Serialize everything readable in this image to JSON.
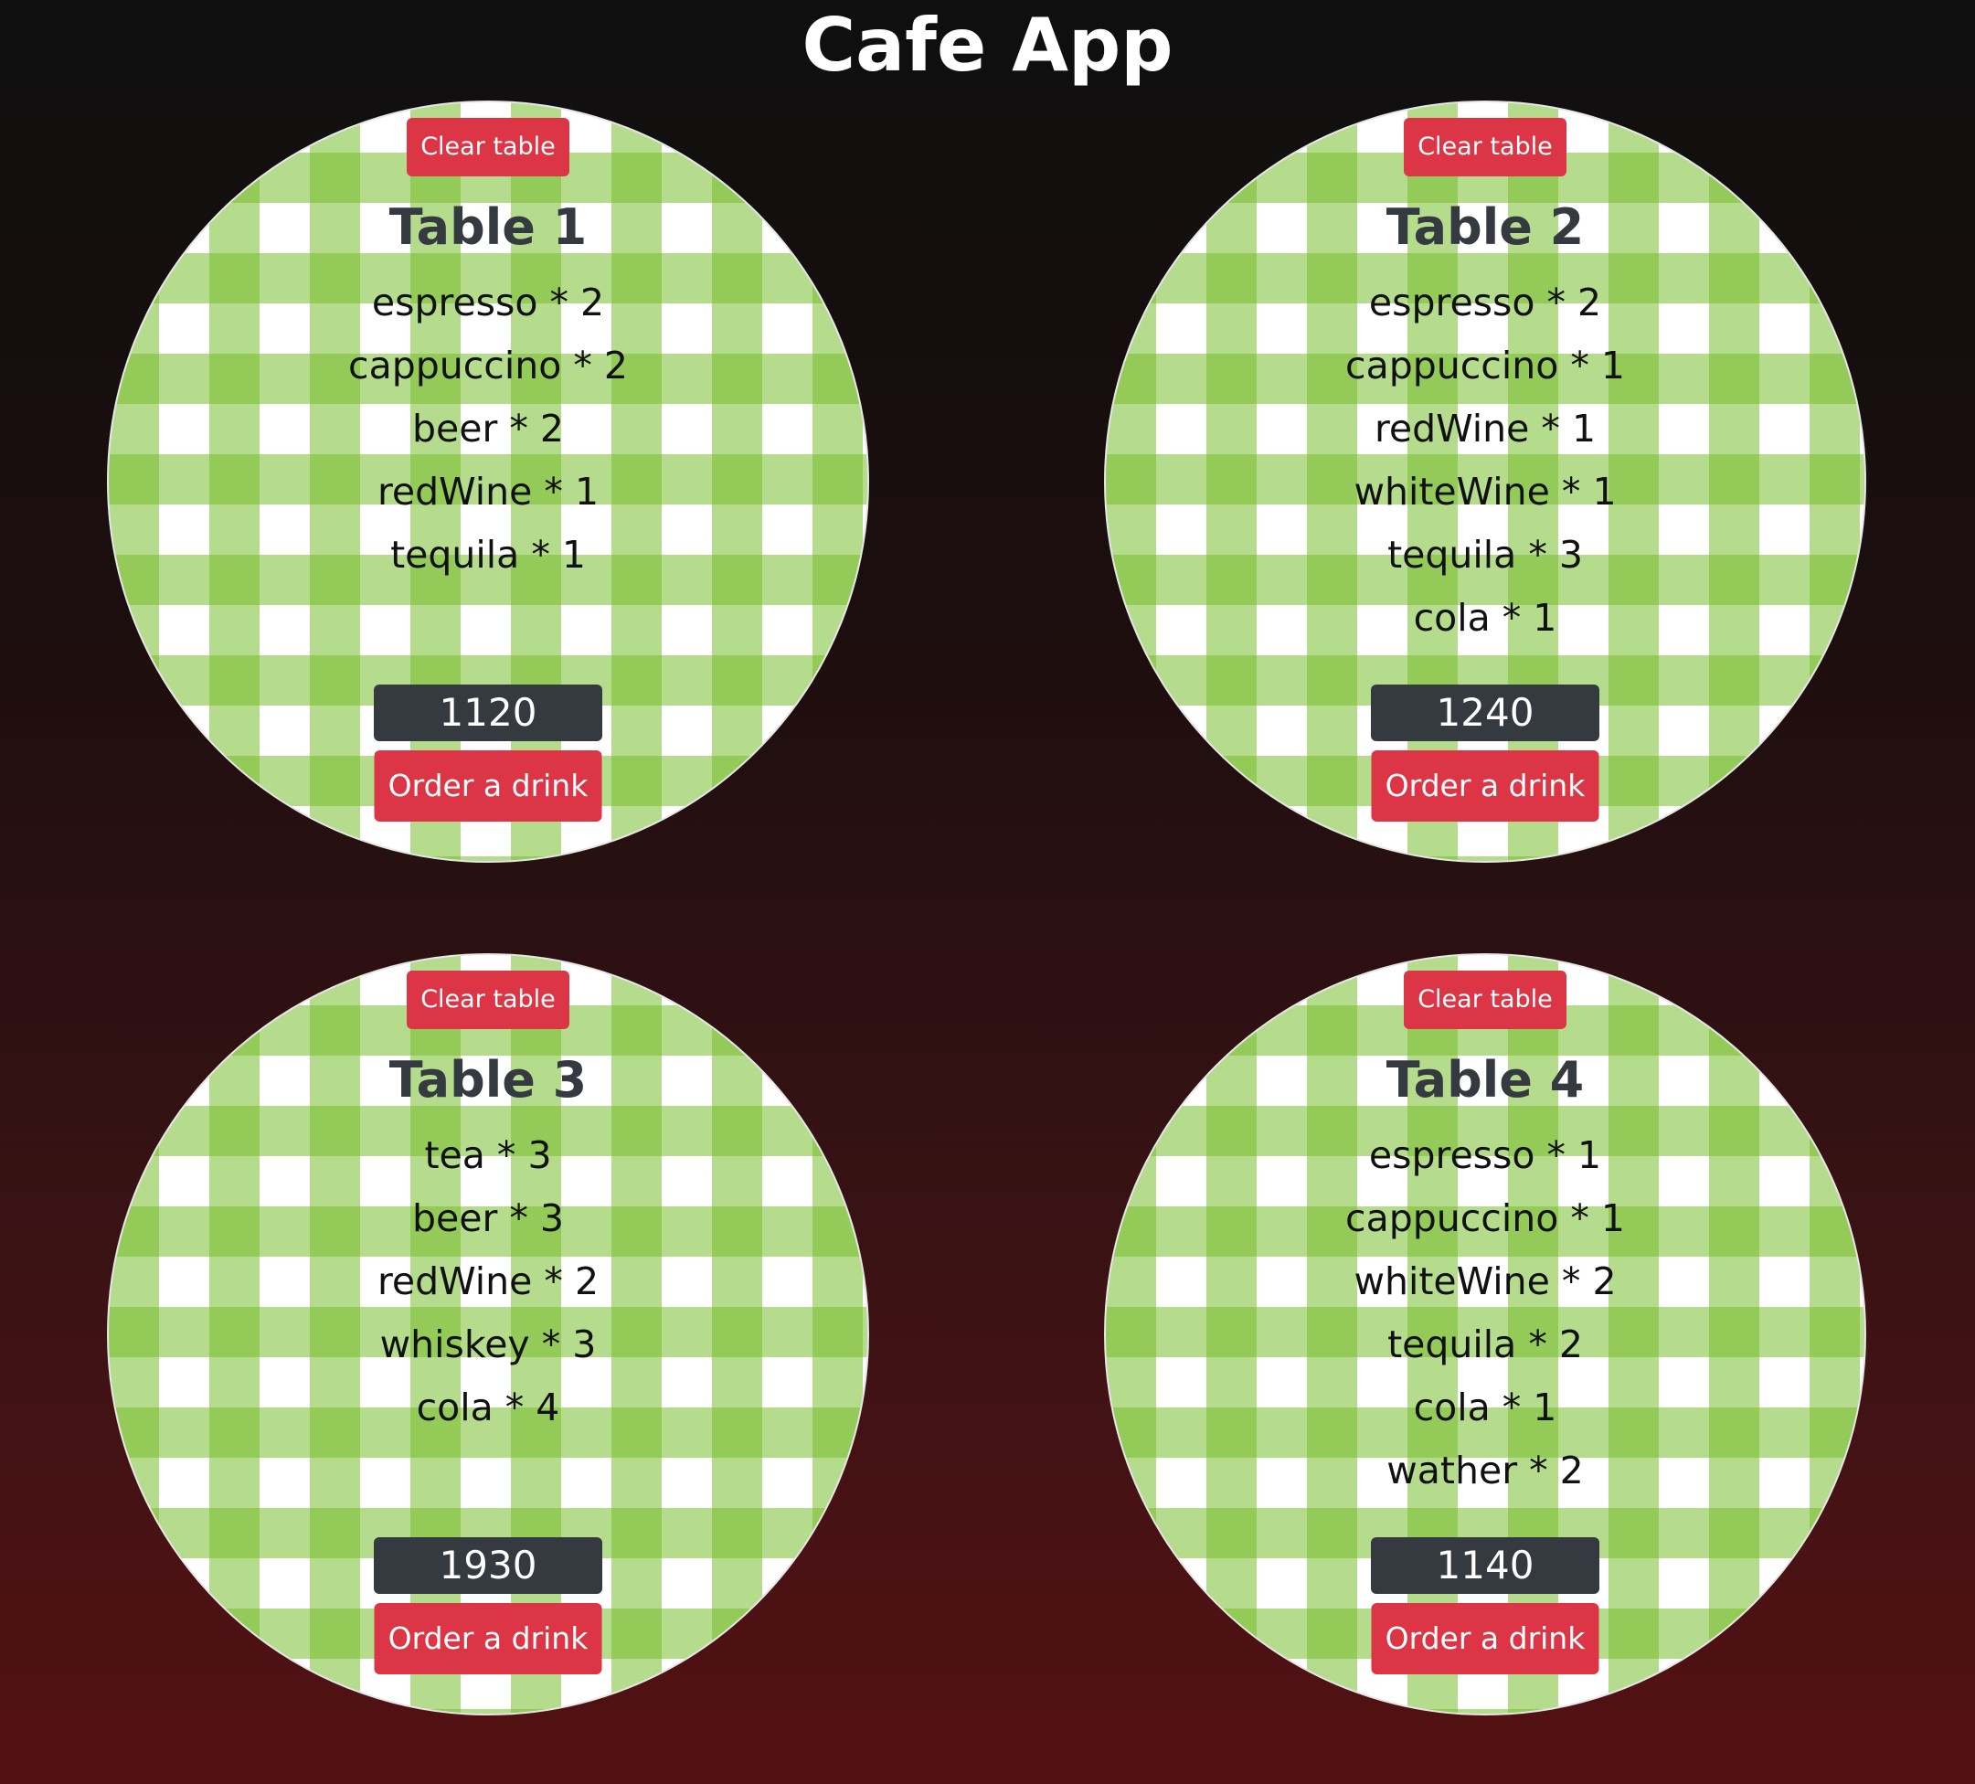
{
  "app": {
    "title": "Cafe App"
  },
  "colors": {
    "danger": "#dc3545",
    "dark": "#343a40",
    "gingham_green": "#78be2d"
  },
  "tables": [
    {
      "clear_label": "Clear table",
      "title": "Table 1",
      "orders": [
        "espresso * 2",
        "cappuccino * 2",
        "beer * 2",
        "redWine * 1",
        "tequila * 1"
      ],
      "total": "1120",
      "order_label": "Order a drink"
    },
    {
      "clear_label": "Clear table",
      "title": "Table 2",
      "orders": [
        "espresso * 2",
        "cappuccino * 1",
        "redWine * 1",
        "whiteWine * 1",
        "tequila * 3",
        "cola * 1"
      ],
      "total": "1240",
      "order_label": "Order a drink"
    },
    {
      "clear_label": "Clear table",
      "title": "Table 3",
      "orders": [
        "tea * 3",
        "beer * 3",
        "redWine * 2",
        "whiskey * 3",
        "cola * 4"
      ],
      "total": "1930",
      "order_label": "Order a drink"
    },
    {
      "clear_label": "Clear table",
      "title": "Table 4",
      "orders": [
        "espresso * 1",
        "cappuccino * 1",
        "whiteWine * 2",
        "tequila * 2",
        "cola * 1",
        "wather * 2"
      ],
      "total": "1140",
      "order_label": "Order a drink"
    }
  ]
}
